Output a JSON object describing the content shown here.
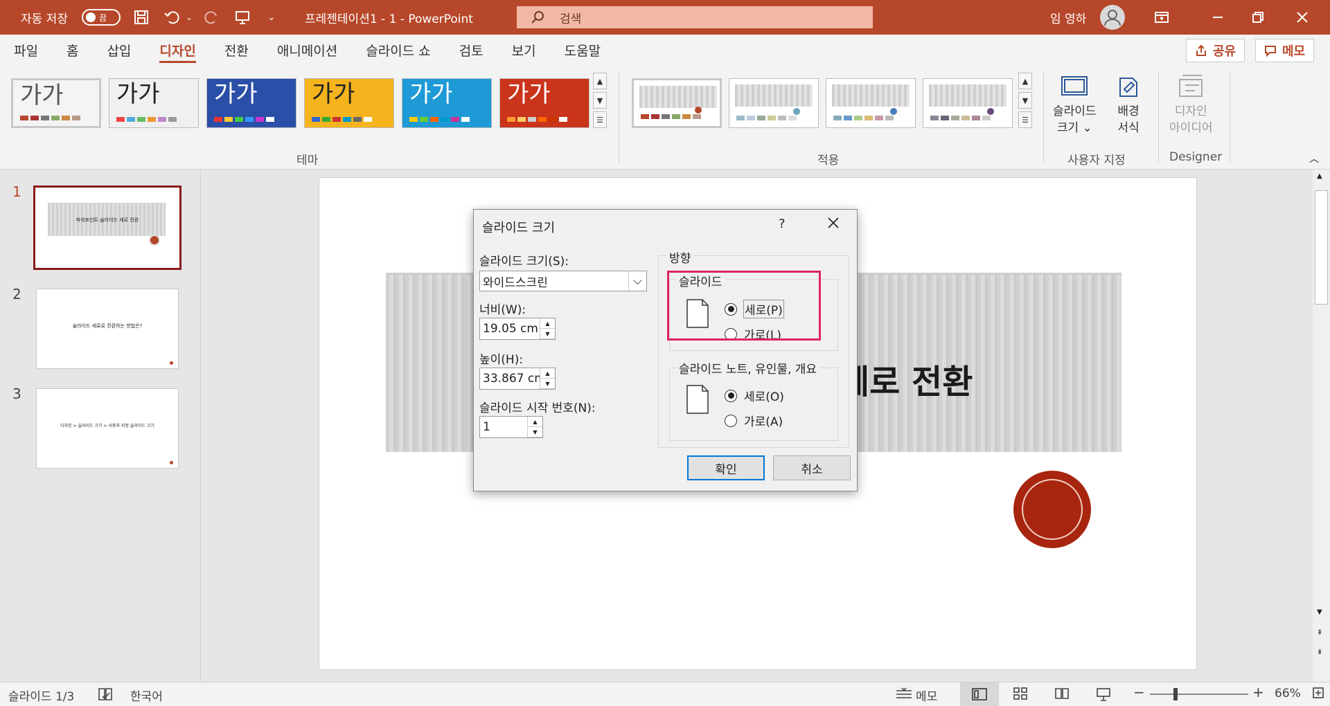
{
  "titlebar": {
    "autosave_label": "자동 저장",
    "autosave_state": "끔",
    "document_title": "프레젠테이션1  -  1  -  PowerPoint",
    "search_placeholder": "검색",
    "user_name": "임 영하"
  },
  "ribbon_tabs": [
    "파일",
    "홈",
    "삽입",
    "디자인",
    "전환",
    "애니메이션",
    "슬라이드 쇼",
    "검토",
    "보기",
    "도움말"
  ],
  "active_tab": "디자인",
  "share_label": "공유",
  "memo_label": "메모",
  "themes": {
    "group_label": "테마",
    "items": [
      {
        "word": "가가",
        "bg": "#f4f4f4",
        "word_color": "#555"
      },
      {
        "word": "가가",
        "bg": "#f0f0f0",
        "word_color": "#222"
      },
      {
        "word": "가가",
        "bg": "#2a4fa8",
        "word_color": "#ffffff"
      },
      {
        "word": "가가",
        "bg": "#f5b41e",
        "word_color": "#222"
      },
      {
        "word": "가가",
        "bg": "#1e9ad6",
        "word_color": "#ffffff"
      },
      {
        "word": "가가",
        "bg": "#c9341a",
        "word_color": "#ffffff"
      }
    ]
  },
  "variants": {
    "group_label": "적용",
    "dot_colors": [
      "#b7472a",
      "#6aa6b8",
      "#4a7db8",
      "#6a4a7a"
    ]
  },
  "customize": {
    "group_label": "사용자 지정",
    "slide_size_label_1": "슬라이드",
    "slide_size_label_2": "크기 ⌄",
    "bg_label_1": "배경",
    "bg_label_2": "서식"
  },
  "designer": {
    "group_label": "Designer",
    "ideas_label_1": "디자인",
    "ideas_label_2": "아이디어"
  },
  "slides_pane": [
    {
      "number": "1",
      "text": "파워포인트 슬라이드 세로 전환"
    },
    {
      "number": "2",
      "text": "슬라이드 세로로 전환하는 방법은?"
    },
    {
      "number": "3",
      "text": "디자인 > 슬라이드 크기 > 사용자 지정 슬라이드 크기"
    }
  ],
  "slide": {
    "title_visible": "세로 전환"
  },
  "dialog": {
    "title": "슬라이드 크기",
    "help": "?",
    "size_label": "슬라이드 크기(S):",
    "size_value": "와이드스크린",
    "width_label": "너비(W):",
    "width_value": "19.05 cm",
    "height_label": "높이(H):",
    "height_value": "33.867 cm",
    "start_label": "슬라이드 시작 번호(N):",
    "start_value": "1",
    "orientation_label": "방향",
    "slide_group_label": "슬라이드",
    "slide_portrait": "세로(P)",
    "slide_landscape": "가로(L)",
    "notes_group_label": "슬라이드 노트, 유인물, 개요",
    "notes_portrait": "세로(O)",
    "notes_landscape": "가로(A)",
    "ok_label": "확인",
    "cancel_label": "취소"
  },
  "statusbar": {
    "slide_info": "슬라이드 1/3",
    "language": "한국어",
    "notes_label": "메모",
    "zoom": "66%"
  }
}
